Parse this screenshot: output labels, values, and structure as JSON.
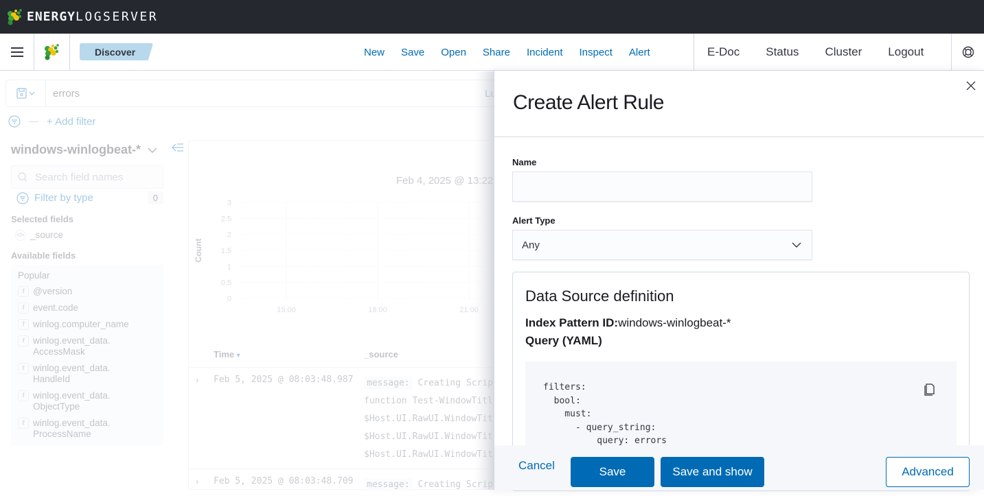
{
  "brand": {
    "name_bold": "ENERGY",
    "name_light": "LOGSERVER"
  },
  "navbar": {
    "breadcrumb": "Discover",
    "links": [
      "New",
      "Save",
      "Open",
      "Share",
      "Incident",
      "Inspect",
      "Alert"
    ],
    "right_links": [
      "E-Doc",
      "Status",
      "Cluster",
      "Logout"
    ],
    "help_icon": "lifebuoy-icon"
  },
  "discover": {
    "query": "errors",
    "query_language": "Lu",
    "add_filter": "+ Add filter",
    "index_pattern": "windows-winlogbeat-*",
    "search_placeholder": "Search field names",
    "filter_by_type": "Filter by type",
    "filter_count": "0",
    "selected_fields_title": "Selected fields",
    "selected_fields": [
      "_source"
    ],
    "available_fields_title": "Available fields",
    "popular_title": "Popular",
    "popular_fields": [
      {
        "type": "t",
        "name": "@version"
      },
      {
        "type": "t",
        "name": "event.code"
      },
      {
        "type": "t",
        "name": "winlog.computer_name"
      },
      {
        "type": "t",
        "name": "winlog.event_data.\nAccessMask"
      },
      {
        "type": "t",
        "name": "winlog.event_data.\nHandleId"
      },
      {
        "type": "t",
        "name": "winlog.event_data.\nObjectType"
      },
      {
        "type": "t",
        "name": "winlog.event_data.\nProcessName"
      }
    ],
    "table": {
      "columns": [
        "Time",
        "_source"
      ],
      "rows": [
        {
          "time": "Feb 5, 2025 @ 08:03:48.987",
          "source_key": "message:",
          "source_lines": [
            "Creating Script",
            "function Test-WindowTitl",
            "$Host.UI.RawUI.WindowTit",
            "$Host.UI.RawUI.WindowTit",
            "$Host.UI.RawUI.WindowTit"
          ]
        },
        {
          "time": "Feb 5, 2025 @ 08:03:48.709",
          "source_key": "message:",
          "source_lines": [
            "Creating Script"
          ]
        }
      ]
    }
  },
  "chart_data": {
    "type": "bar",
    "title": "Feb 4, 2025 @ 13:22",
    "xlabel": "",
    "ylabel": "Count",
    "x_ticks": [
      "15:00",
      "18:00",
      "21:00"
    ],
    "y_ticks": [
      "0",
      "0.5",
      "1",
      "1.5",
      "2",
      "2.5",
      "3"
    ],
    "ylim": [
      0,
      3
    ],
    "categories": [],
    "values": [],
    "grid": true
  },
  "flyout": {
    "title": "Create Alert Rule",
    "name_label": "Name",
    "name_value": "",
    "alert_type_label": "Alert Type",
    "alert_type_value": "Any",
    "data_source": {
      "title": "Data Source definition",
      "index_pattern_label": "Index Pattern ID:",
      "index_pattern_value": "windows-winlogbeat-*",
      "query_label": "Query (YAML)",
      "query_yaml": "filters:\n  bool:\n    must:\n      - query_string:\n          query: errors"
    },
    "buttons": {
      "cancel": "Cancel",
      "save": "Save",
      "save_and_show": "Save and show",
      "advanced": "Advanced"
    }
  },
  "colors": {
    "topbar": "#25282f",
    "accent": "#006bb4",
    "breadcrumb": "#b8d8ec"
  }
}
